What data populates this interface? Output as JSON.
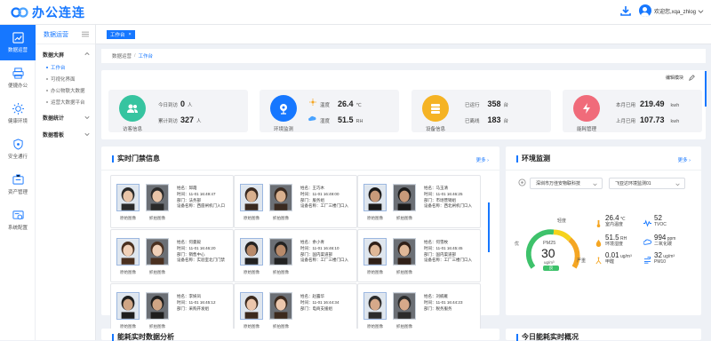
{
  "brand": {
    "name": "办公连连",
    "color": "#1677ff"
  },
  "header": {
    "user": "欢迎您,xqa_zhlog"
  },
  "iconbar": [
    {
      "label": "数据运营",
      "icon": "chart-icon",
      "active": true
    },
    {
      "label": "便捷办公",
      "icon": "printer-icon"
    },
    {
      "label": "健康环境",
      "icon": "sun-icon"
    },
    {
      "label": "安全通行",
      "icon": "shield-icon"
    },
    {
      "label": "资产管理",
      "icon": "asset-icon"
    },
    {
      "label": "系统配置",
      "icon": "settings-icon"
    }
  ],
  "submenu": {
    "title": "数据运营",
    "group1": "数据大屏",
    "items": [
      "工作台",
      "可视化界面",
      "办公物联大数据",
      "运营大数据平台"
    ],
    "group2": "数据统计",
    "group3": "数据看板"
  },
  "tab": {
    "label": "工作台",
    "close": "×"
  },
  "breadcrumb": {
    "root": "数据运营",
    "sep": "/",
    "current": "工作台"
  },
  "stats": {
    "edit_label": "编辑模块",
    "visitors": {
      "label": "访客信息",
      "today_label": "今日到访",
      "today": "0",
      "today_unit": "人",
      "total_label": "累计到访",
      "total": "327",
      "total_unit": "人"
    },
    "env": {
      "label": "环境监测",
      "temp_label": "温度",
      "temp": "26.4",
      "temp_unit": "℃",
      "hum_label": "湿度",
      "hum": "51.5",
      "hum_unit": "RH"
    },
    "devices": {
      "label": "设备信息",
      "online_label": "已运行",
      "online": "358",
      "online_unit": "台",
      "offline_label": "已离线",
      "offline": "183",
      "offline_unit": "台"
    },
    "energy": {
      "label": "能耗管理",
      "month_label": "本月已用",
      "month": "219.49",
      "month_unit": "kwh",
      "last_label": "上月已用",
      "last": "107.73",
      "last_unit": "kwh"
    }
  },
  "access": {
    "title": "实时门禁信息",
    "more": "更多",
    "orig_label": "原始图像",
    "snap_label": "抓拍图像",
    "records": [
      {
        "name": "姓名：邱霞",
        "time": "时间：11-01 16:49:47",
        "dept": "部门：法务部",
        "device": "设备名称：西座闸机门入口"
      },
      {
        "name": "姓名：王巧木",
        "time": "时间：11-01 16:49:00",
        "dept": "部门：服务组",
        "device": "设备名称：工厂三楼门口入"
      },
      {
        "name": "姓名：马玉清",
        "time": "时间：11-01 16:46:25",
        "dept": "部门：市场营销组",
        "device": "设备名称：西北闸机门口入"
      },
      {
        "name": "姓名：何曼毅",
        "time": "时间：11-01 16:46:20",
        "dept": "部门：销售中心",
        "device": "设备名称：实验室北门门禁"
      },
      {
        "name": "姓名：余小青",
        "time": "时间：11-01 16:46:10",
        "dept": "部门：国内渠道部",
        "device": "设备名称：工厂三楼门口入"
      },
      {
        "name": "姓名：何雪枚",
        "time": "时间：11-01 16:45:45",
        "dept": "部门：国内渠道部",
        "device": "设备名称：工厂三楼门口入"
      },
      {
        "name": "姓名：李妍凤",
        "time": "时间：11-01 16:45:12",
        "dept": "部门：采购开发组",
        "device": ""
      },
      {
        "name": "姓名：赵露华",
        "time": "时间：11-01 16:44:34",
        "dept": "部门：电商支援组",
        "device": ""
      },
      {
        "name": "姓名：刘楠雁",
        "time": "时间：11-01 16:44:23",
        "dept": "部门：税务服务",
        "device": ""
      }
    ]
  },
  "environment": {
    "title": "环境监测",
    "more": "更多",
    "location": "深圳市万佳安物联科技",
    "device": "飞亚达环境监测01",
    "gauge": {
      "top": "轻度",
      "left": "优",
      "right": "严重",
      "name": "PM25",
      "value": "30",
      "unit": "ug/m³",
      "badge": "良"
    },
    "temp": "26.4",
    "temp_unit": "℃",
    "temp_label": "室内温度",
    "hum": "51.5",
    "hum_unit": "RH",
    "hum_label": "环境湿度",
    "hcho": "0.01",
    "hcho_unit": "ug/m³",
    "hcho_label": "甲醛",
    "tvoc": "52",
    "tvoc_label": "TVOC",
    "co2": "994",
    "co2_unit": "ppm",
    "co2_label": "二氧化碳",
    "pm10": "32",
    "pm10_unit": "ug/m³",
    "pm10_label": "PM10"
  },
  "bottom": {
    "left": "能耗实时数据分析",
    "right": "今日能耗实时概况"
  }
}
